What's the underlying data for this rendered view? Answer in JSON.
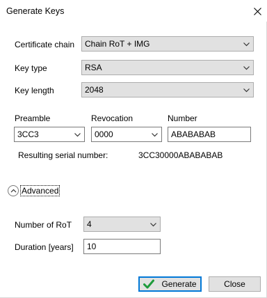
{
  "window": {
    "title": "Generate Keys"
  },
  "fields": {
    "certificate_chain": {
      "label": "Certificate chain",
      "value": "Chain RoT + IMG"
    },
    "key_type": {
      "label": "Key type",
      "value": "RSA"
    },
    "key_length": {
      "label": "Key length",
      "value": "2048"
    }
  },
  "serial": {
    "preamble": {
      "label": "Preamble",
      "value": "3CC3"
    },
    "revocation": {
      "label": "Revocation",
      "value": "0000"
    },
    "number": {
      "label": "Number",
      "value": "ABABABAB"
    },
    "result_label": "Resulting serial number:",
    "result_value": "3CC30000ABABABAB"
  },
  "advanced": {
    "label": "Advanced",
    "number_of_rot": {
      "label": "Number of RoT",
      "value": "4"
    },
    "duration": {
      "label": "Duration [years]",
      "value": "10"
    }
  },
  "buttons": {
    "generate": "Generate",
    "close": "Close"
  },
  "colors": {
    "accent": "#0078d7",
    "check": "#1e9b3b"
  },
  "icons": {
    "close": "close-icon",
    "chevron": "chevron-down-icon",
    "advanced_toggle": "chevron-up-icon",
    "generate": "checkmark-icon"
  }
}
